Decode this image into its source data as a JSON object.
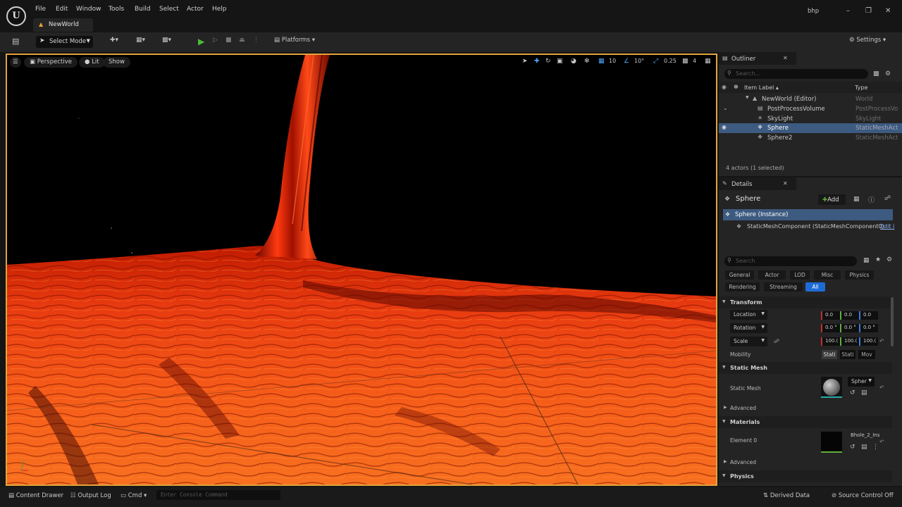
{
  "app": {
    "menu": [
      "File",
      "Edit",
      "Window",
      "Tools",
      "Build",
      "Select",
      "Actor",
      "Help"
    ],
    "project_tab": "NewWorld",
    "user": "bhp",
    "window_controls": [
      "–",
      "❐",
      "✕"
    ]
  },
  "toolbar": {
    "select_mode": "Select Mode",
    "platforms": "Platforms",
    "settings": "Settings"
  },
  "viewport": {
    "perspective": "Perspective",
    "lit": "Lit",
    "show": "Show",
    "grid_snap": "10",
    "rot_snap": "10°",
    "scale_snap": "0.25",
    "camera_speed": "4"
  },
  "outliner": {
    "title": "Outliner",
    "search_placeholder": "Search...",
    "col_label": "Item Label ▴",
    "col_type": "Type",
    "rows": [
      {
        "label": "NewWorld (Editor)",
        "type": "World"
      },
      {
        "label": "PostProcessVolume",
        "type": "PostProcessVolume"
      },
      {
        "label": "SkyLight",
        "type": "SkyLight"
      },
      {
        "label": "Sphere",
        "type": "StaticMeshActor"
      },
      {
        "label": "Sphere2",
        "type": "StaticMeshActor"
      }
    ],
    "footer": "4 actors (1 selected)"
  },
  "details": {
    "title": "Details",
    "actor_name": "Sphere",
    "add_label": "Add",
    "instance": "Sphere (Instance)",
    "component": "StaticMeshComponent (StaticMeshComponent0)",
    "edit_link": "Edit i",
    "search_placeholder": "Search",
    "filters_row1": [
      "General",
      "Actor",
      "LOD",
      "Misc",
      "Physics"
    ],
    "filters_row2": [
      "Rendering",
      "Streaming",
      "All"
    ],
    "transform": {
      "header": "Transform",
      "location_label": "Location",
      "location": [
        "0.0",
        "0.0",
        "0.0"
      ],
      "rotation_label": "Rotation",
      "rotation": [
        "0.0 °",
        "0.0 °",
        "0.0 °"
      ],
      "scale_label": "Scale",
      "scale": [
        "100.(",
        "100.(",
        "100.("
      ],
      "mobility_label": "Mobility",
      "mobility": [
        "Stati",
        "Stati",
        "Mov"
      ]
    },
    "static_mesh": {
      "header": "Static Mesh",
      "label": "Static Mesh",
      "value": "Spher"
    },
    "advanced1": "Advanced",
    "materials": {
      "header": "Materials",
      "element_label": "Element 0",
      "value": "Bhole_2_Ins"
    },
    "advanced2": "Advanced",
    "physics": "Physics"
  },
  "statusbar": {
    "content_drawer": "Content Drawer",
    "output_log": "Output Log",
    "cmd": "Cmd",
    "console_placeholder": "Enter Console Command",
    "derived_data": "Derived Data",
    "source_control": "Source Control Off"
  }
}
